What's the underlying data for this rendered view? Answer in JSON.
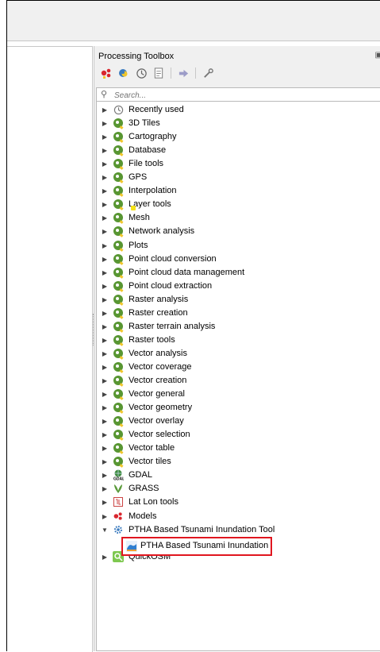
{
  "panel": {
    "title": "Processing Toolbox",
    "search_placeholder": "Search...",
    "colors": {
      "accent_red": "#e0161f",
      "qgis_green": "#589632"
    }
  },
  "toolbar": [
    {
      "icon": "models-icon"
    },
    {
      "icon": "python-script-icon"
    },
    {
      "icon": "history-icon"
    },
    {
      "icon": "results-viewer-icon"
    },
    {
      "icon": "edit-features-in-place-icon"
    },
    {
      "icon": "options-wrench-icon"
    }
  ],
  "tree": [
    {
      "label": "Recently used",
      "icon": "clock-icon"
    },
    {
      "label": "3D Tiles",
      "icon": "qgis-icon"
    },
    {
      "label": "Cartography",
      "icon": "qgis-icon"
    },
    {
      "label": "Database",
      "icon": "qgis-icon"
    },
    {
      "label": "File tools",
      "icon": "qgis-icon"
    },
    {
      "label": "GPS",
      "icon": "qgis-icon"
    },
    {
      "label": "Interpolation",
      "icon": "qgis-icon"
    },
    {
      "label": "Layer tools",
      "icon": "qgis-icon"
    },
    {
      "label": "Mesh",
      "icon": "qgis-icon"
    },
    {
      "label": "Network analysis",
      "icon": "qgis-icon"
    },
    {
      "label": "Plots",
      "icon": "qgis-icon"
    },
    {
      "label": "Point cloud conversion",
      "icon": "qgis-icon"
    },
    {
      "label": "Point cloud data management",
      "icon": "qgis-icon"
    },
    {
      "label": "Point cloud extraction",
      "icon": "qgis-icon"
    },
    {
      "label": "Raster analysis",
      "icon": "qgis-icon"
    },
    {
      "label": "Raster creation",
      "icon": "qgis-icon"
    },
    {
      "label": "Raster terrain analysis",
      "icon": "qgis-icon"
    },
    {
      "label": "Raster tools",
      "icon": "qgis-icon"
    },
    {
      "label": "Vector analysis",
      "icon": "qgis-icon"
    },
    {
      "label": "Vector coverage",
      "icon": "qgis-icon"
    },
    {
      "label": "Vector creation",
      "icon": "qgis-icon"
    },
    {
      "label": "Vector general",
      "icon": "qgis-icon"
    },
    {
      "label": "Vector geometry",
      "icon": "qgis-icon"
    },
    {
      "label": "Vector overlay",
      "icon": "qgis-icon"
    },
    {
      "label": "Vector selection",
      "icon": "qgis-icon"
    },
    {
      "label": "Vector table",
      "icon": "qgis-icon"
    },
    {
      "label": "Vector tiles",
      "icon": "qgis-icon"
    },
    {
      "label": "GDAL",
      "icon": "gdal-icon"
    },
    {
      "label": "GRASS",
      "icon": "grass-icon"
    },
    {
      "label": "Lat Lon tools",
      "icon": "latlon-icon"
    },
    {
      "label": "Models",
      "icon": "models-icon"
    },
    {
      "label": "PTHA Based Tsunami Inundation Tool",
      "icon": "gear-icon",
      "expanded": true
    },
    {
      "label": "PTHA Based Tsunami Inundation",
      "icon": "tsunami-wave-icon",
      "child": true,
      "highlighted": true
    },
    {
      "label": "QuickOSM",
      "icon": "quickosm-icon"
    }
  ]
}
